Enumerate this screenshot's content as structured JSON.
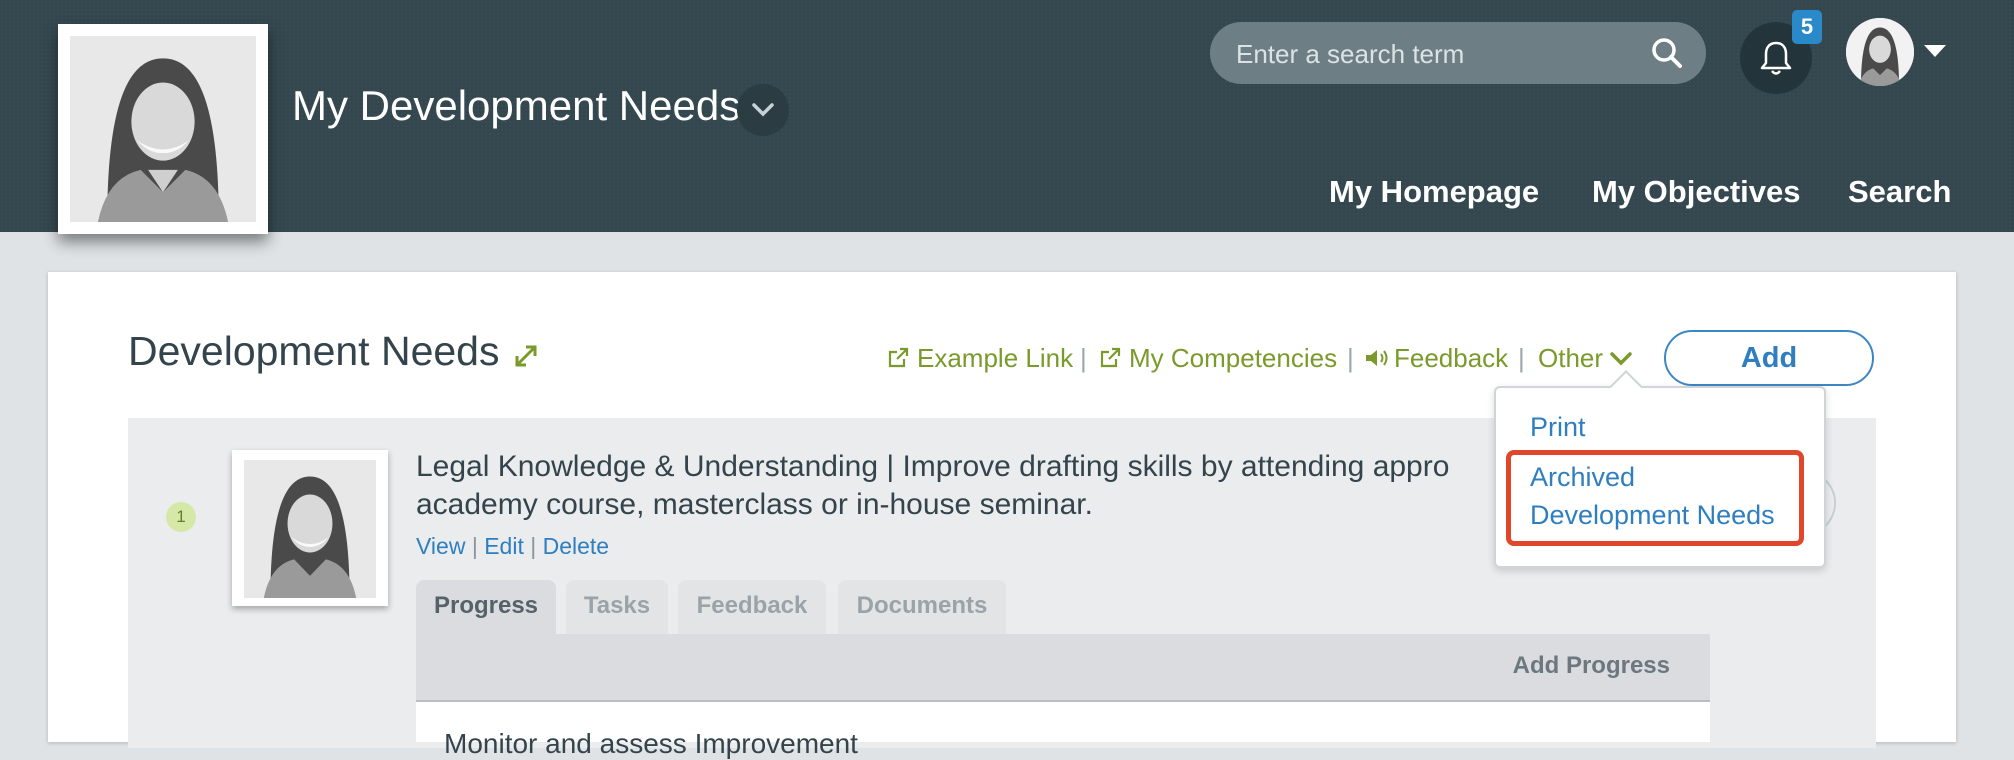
{
  "header": {
    "title": "My Development Needs",
    "search_placeholder": "Enter a search term",
    "notification_count": "5",
    "nav": [
      "My Homepage",
      "My Objectives",
      "Search"
    ]
  },
  "panel": {
    "title": "Development Needs",
    "links": {
      "example_link": "Example Link",
      "my_competencies": "My Competencies",
      "feedback": "Feedback",
      "other": "Other"
    },
    "add_label": "Add",
    "dropdown": {
      "print": "Print",
      "archived_line1": "Archived",
      "archived_line2": "Development Needs"
    },
    "item": {
      "number": "1",
      "text": "Legal Knowledge & Understanding | Improve drafting skills by attending appro academy course, masterclass or in-house seminar.",
      "actions": [
        "View",
        "Edit",
        "Delete"
      ],
      "tabs": [
        "Progress",
        "Tasks",
        "Feedback",
        "Documents"
      ],
      "add_progress": "Add Progress",
      "partial_text": "Monitor and assess Improvement"
    }
  },
  "colors": {
    "header_bg": "#34474f",
    "link_green": "#7a9a2b",
    "link_blue": "#2f7fc0",
    "highlight_red": "#e0472a"
  }
}
